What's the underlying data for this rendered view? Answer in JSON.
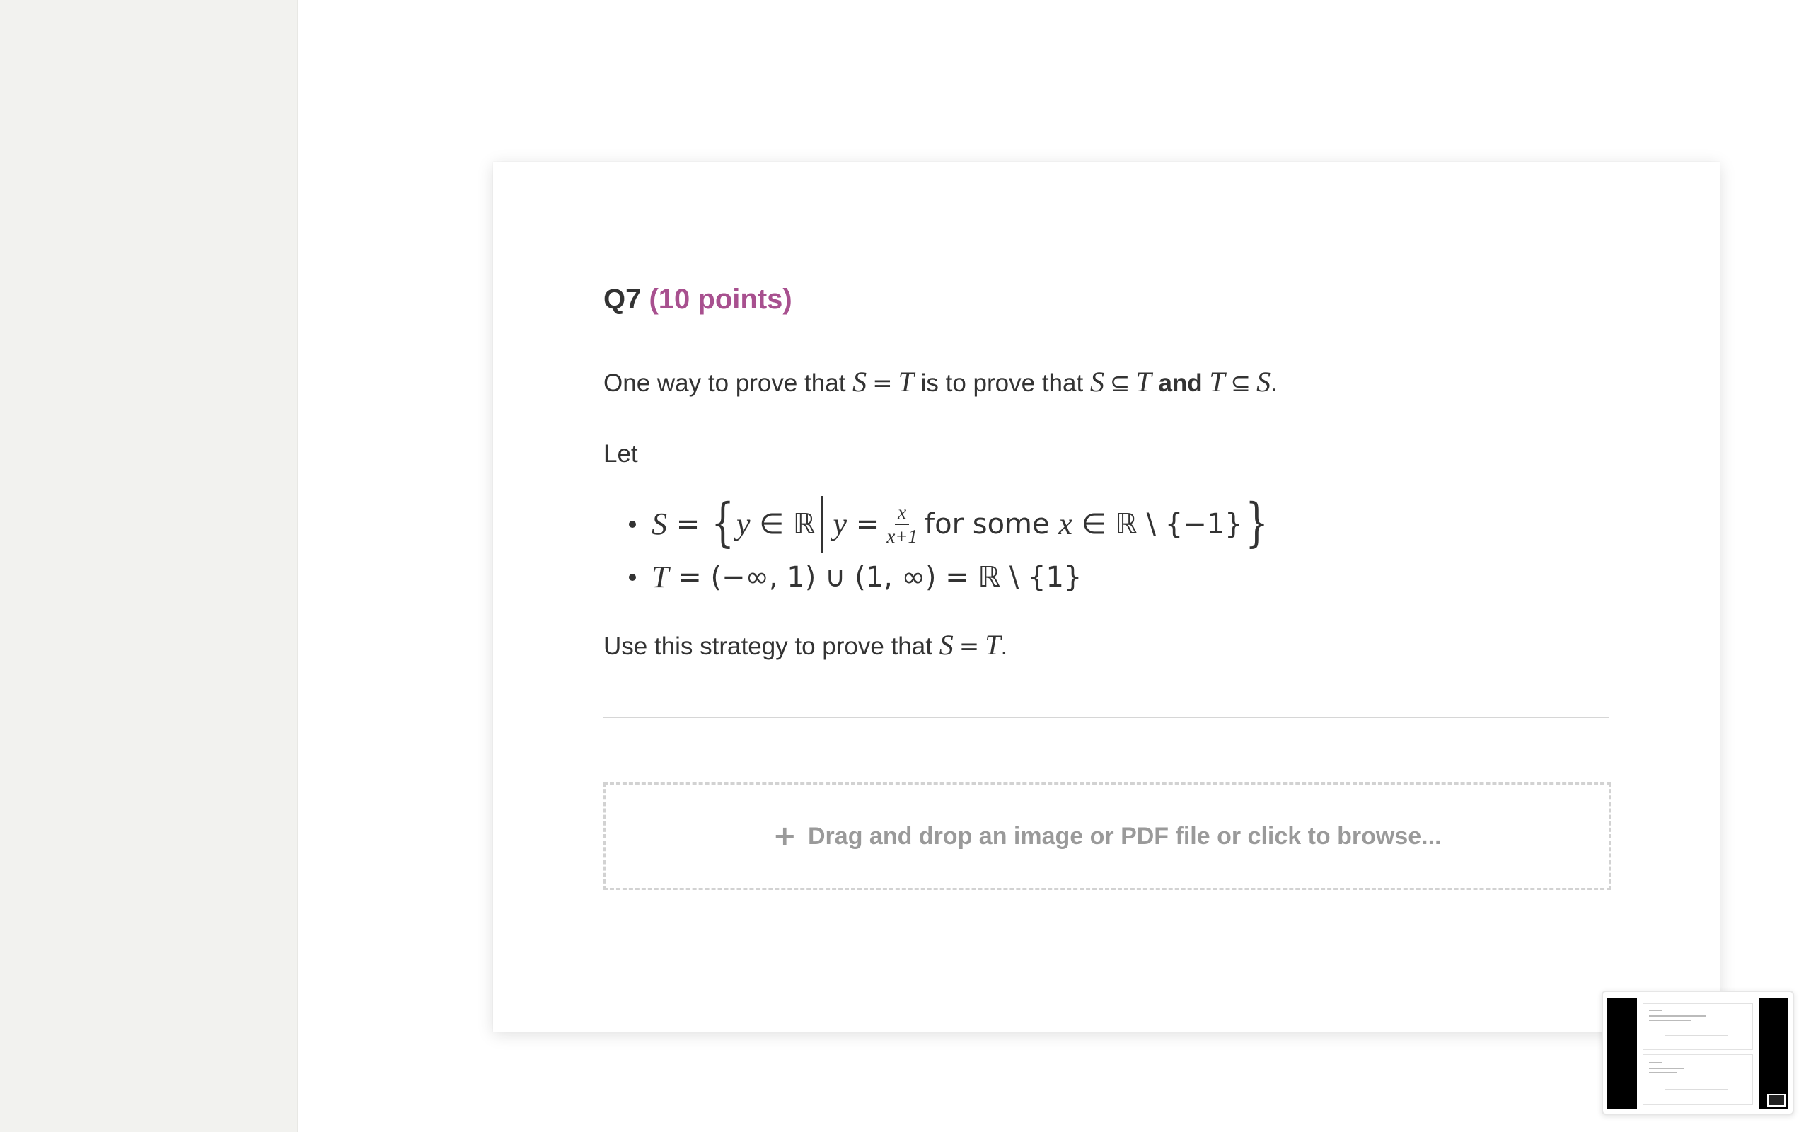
{
  "question": {
    "number": "Q7",
    "points": "(10 points)",
    "intro_pre": "One way to prove that",
    "S": "S",
    "T": "T",
    "eq": "=",
    "subset": "⊆",
    "is_to_prove": "is to prove that",
    "and": "and",
    "period": ".",
    "let": "Let",
    "set_S": {
      "lhs": "S",
      "eq": "=",
      "brace_open": "{",
      "y": "y",
      "in": "∈",
      "reals": "ℝ",
      "y2": "y",
      "eq2": "=",
      "frac_num": "x",
      "frac_den": "x+1",
      "for_some": "for some",
      "x": "x",
      "in2": "∈",
      "reals2": "ℝ",
      "minus_set": "\\ {−1}",
      "brace_close": "}"
    },
    "set_T": {
      "lhs": "T",
      "eq": "=",
      "expr": "(−∞, 1) ∪ (1, ∞) = ℝ \\ {1}"
    },
    "use_pre": "Use this strategy to prove that",
    "upload_icon": "plus-icon",
    "upload_label": "Drag and drop an image or PDF file or click to browse..."
  },
  "colors": {
    "accent": "#a8508f",
    "text": "#333333",
    "muted": "#9a9a9a",
    "sidebar_bg": "#f2f2ef"
  }
}
